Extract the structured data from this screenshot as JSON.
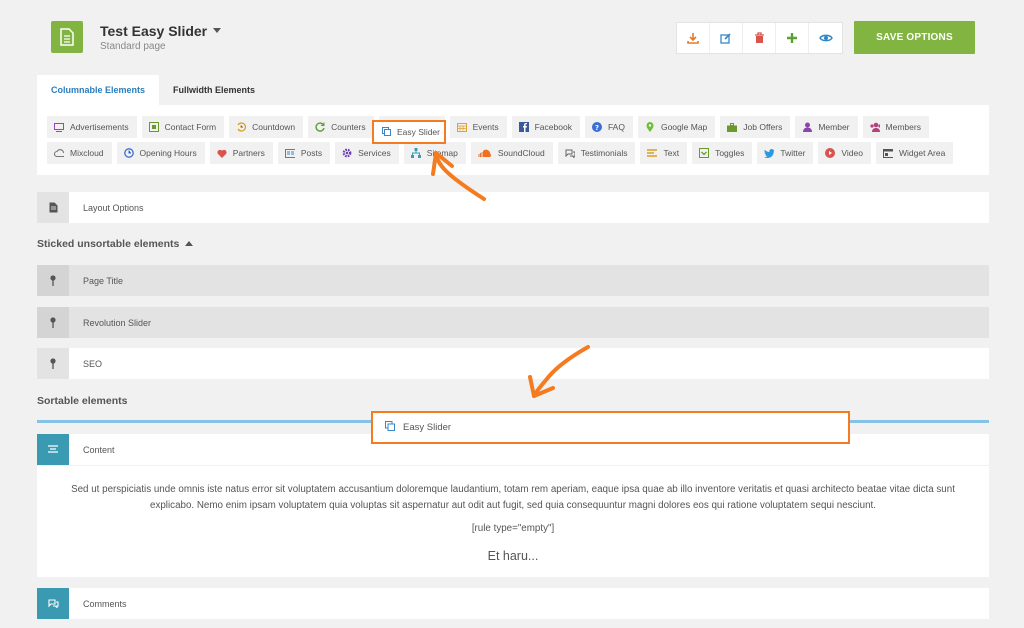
{
  "header": {
    "title": "Test Easy Slider",
    "subtitle": "Standard page",
    "save_label": "SAVE OPTIONS",
    "tools": [
      "download-icon",
      "edit-icon",
      "trash-icon",
      "plus-icon",
      "eye-icon"
    ]
  },
  "tabs": [
    {
      "label": "Columnable Elements",
      "active": true
    },
    {
      "label": "Fullwidth Elements",
      "active": false
    }
  ],
  "elements_row1": [
    {
      "label": "Advertisements",
      "icon": "monitor-icon"
    },
    {
      "label": "Contact Form",
      "icon": "form-icon"
    },
    {
      "label": "Countdown",
      "icon": "countdown-icon"
    },
    {
      "label": "Counters",
      "icon": "refresh-icon"
    },
    {
      "label": "",
      "icon": ""
    },
    {
      "label": "Events",
      "icon": "calendar-icon"
    },
    {
      "label": "Facebook",
      "icon": "facebook-icon"
    },
    {
      "label": "FAQ",
      "icon": "question-icon"
    },
    {
      "label": "Google Map",
      "icon": "map-pin-icon"
    },
    {
      "label": "Job Offers",
      "icon": "briefcase-icon"
    },
    {
      "label": "Member",
      "icon": "user-icon"
    },
    {
      "label": "Members",
      "icon": "users-icon"
    }
  ],
  "elements_row2": [
    {
      "label": "Mixcloud",
      "icon": "cloud-icon"
    },
    {
      "label": "Opening Hours",
      "icon": "clock-icon"
    },
    {
      "label": "Partners",
      "icon": "heart-icon"
    },
    {
      "label": "Posts",
      "icon": "posts-icon"
    },
    {
      "label": "Services",
      "icon": "gear-icon"
    },
    {
      "label": "Sitemap",
      "icon": "sitemap-icon"
    },
    {
      "label": "SoundCloud",
      "icon": "soundcloud-icon"
    },
    {
      "label": "Testimonials",
      "icon": "comments-icon"
    },
    {
      "label": "Text",
      "icon": "text-icon"
    },
    {
      "label": "Toggles",
      "icon": "toggle-icon"
    },
    {
      "label": "Twitter",
      "icon": "twitter-icon"
    },
    {
      "label": "Video",
      "icon": "play-icon"
    },
    {
      "label": "Widget Area",
      "icon": "widget-icon"
    }
  ],
  "layout_options_label": "Layout Options",
  "sticked_heading": "Sticked unsortable elements",
  "sticked": [
    {
      "label": "Page Title"
    },
    {
      "label": "Revolution Slider"
    },
    {
      "label": "SEO"
    }
  ],
  "sortable_heading": "Sortable elements",
  "drag_ghost_label": "Easy Slider",
  "drop_ghost_label": "Easy Slider",
  "content_section": {
    "label": "Content",
    "paragraph": "Sed ut perspiciatis unde omnis iste natus error sit voluptatem accusantium doloremque laudantium, totam rem aperiam, eaque ipsa quae ab illo inventore veritatis et quasi architecto beatae vitae dicta sunt explicabo. Nemo enim ipsam voluptatem quia voluptas sit aspernatur aut odit aut fugit, sed quia consequuntur magni dolores eos qui ratione voluptatem sequi nesciunt.",
    "rule": "[rule type=\"empty\"]",
    "more": "Et haru..."
  },
  "comments_label": "Comments",
  "colors": {
    "accent_green": "#81b441",
    "link_blue": "#2a7dbd",
    "handle_blue": "#3a9ab1",
    "highlight_orange": "#f47b20",
    "drop_line": "#85c2e6"
  }
}
